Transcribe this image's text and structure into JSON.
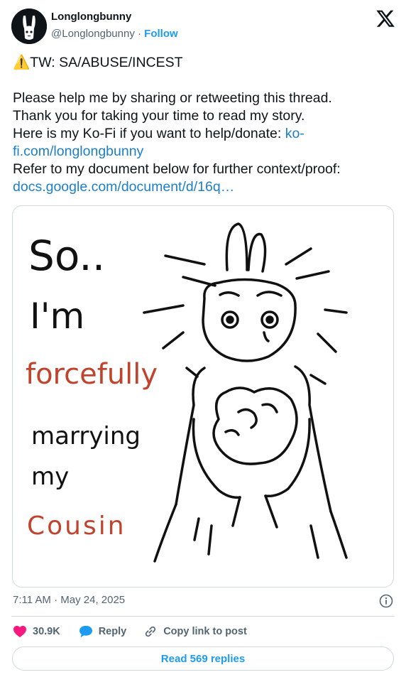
{
  "header": {
    "display_name": "Longlongbunny",
    "handle": "@Longlongbunny",
    "separator": "·",
    "follow_label": "Follow"
  },
  "tweet": {
    "warning_emoji": "⚠️",
    "warning_text": "TW: SA/ABUSE/INCEST",
    "line1": "Please help me by sharing or retweeting this thread.",
    "line2": "Thank you for taking your time to read my story.",
    "line3_text": "Here is my Ko-Fi if you want to help/donate: ",
    "kofi_link_a": "ko-",
    "kofi_link_b": "fi.com/longlongbunny",
    "line4": "Refer to my document below for further context/proof:",
    "doc_link": "docs.google.com/document/d/16q…"
  },
  "image_text": {
    "line1": "So..",
    "line2": "I'm",
    "line3": "forcefully",
    "line4": "marrying",
    "line5": "my",
    "line6": "Cousin"
  },
  "colors": {
    "accent": "#1d9bf0",
    "link": "#1d7fc7",
    "like": "#f91880",
    "reply": "#1d9bf0",
    "red_text": "#c0432e"
  },
  "footer": {
    "timestamp": "7:11 AM · May 24, 2025",
    "like_count": "30.9K",
    "reply_label": "Reply",
    "copy_link_label": "Copy link to post",
    "read_replies_label": "Read 569 replies"
  },
  "icons": {
    "logo": "x-logo-icon",
    "info": "info-icon",
    "like": "heart-icon",
    "reply": "speech-bubble-icon",
    "copy": "link-icon"
  }
}
